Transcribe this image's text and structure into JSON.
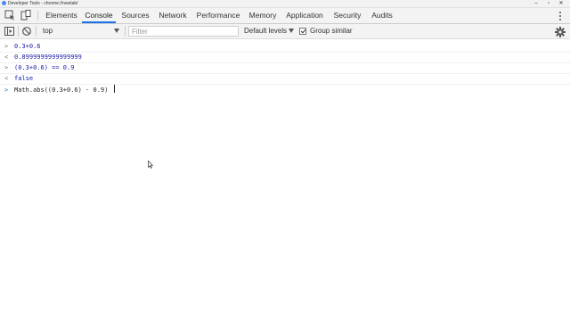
{
  "window": {
    "title": "Developer Tools - chrome://newtab/",
    "controls": {
      "minimize": "–",
      "maximize": "▫",
      "close": "✕"
    }
  },
  "tabs": [
    {
      "label": "Elements",
      "active": false
    },
    {
      "label": "Console",
      "active": true
    },
    {
      "label": "Sources",
      "active": false
    },
    {
      "label": "Network",
      "active": false
    },
    {
      "label": "Performance",
      "active": false
    },
    {
      "label": "Memory",
      "active": false
    },
    {
      "label": "Application",
      "active": false
    },
    {
      "label": "Security",
      "active": false
    },
    {
      "label": "Audits",
      "active": false
    }
  ],
  "toolbar": {
    "context": "top",
    "filter_placeholder": "Filter",
    "levels": "Default levels",
    "group_similar_label": "Group similar",
    "group_similar_checked": true
  },
  "console": {
    "rows": [
      {
        "kind": "input",
        "glyph": ">",
        "text": "0.3+0.6"
      },
      {
        "kind": "result",
        "glyph": "<",
        "text": "0.8999999999999999"
      },
      {
        "kind": "input",
        "glyph": ">",
        "text": "(0.3+0.6) == 0.9"
      },
      {
        "kind": "result",
        "glyph": "<",
        "text": "false"
      }
    ],
    "prompt": {
      "glyph": ">",
      "text": "Math.abs((0.3+0.6) - 0.9) "
    }
  },
  "colors": {
    "accent": "#1a73e8",
    "code_blue": "#1a1aa6",
    "toolbar_bg": "#f3f3f3"
  }
}
